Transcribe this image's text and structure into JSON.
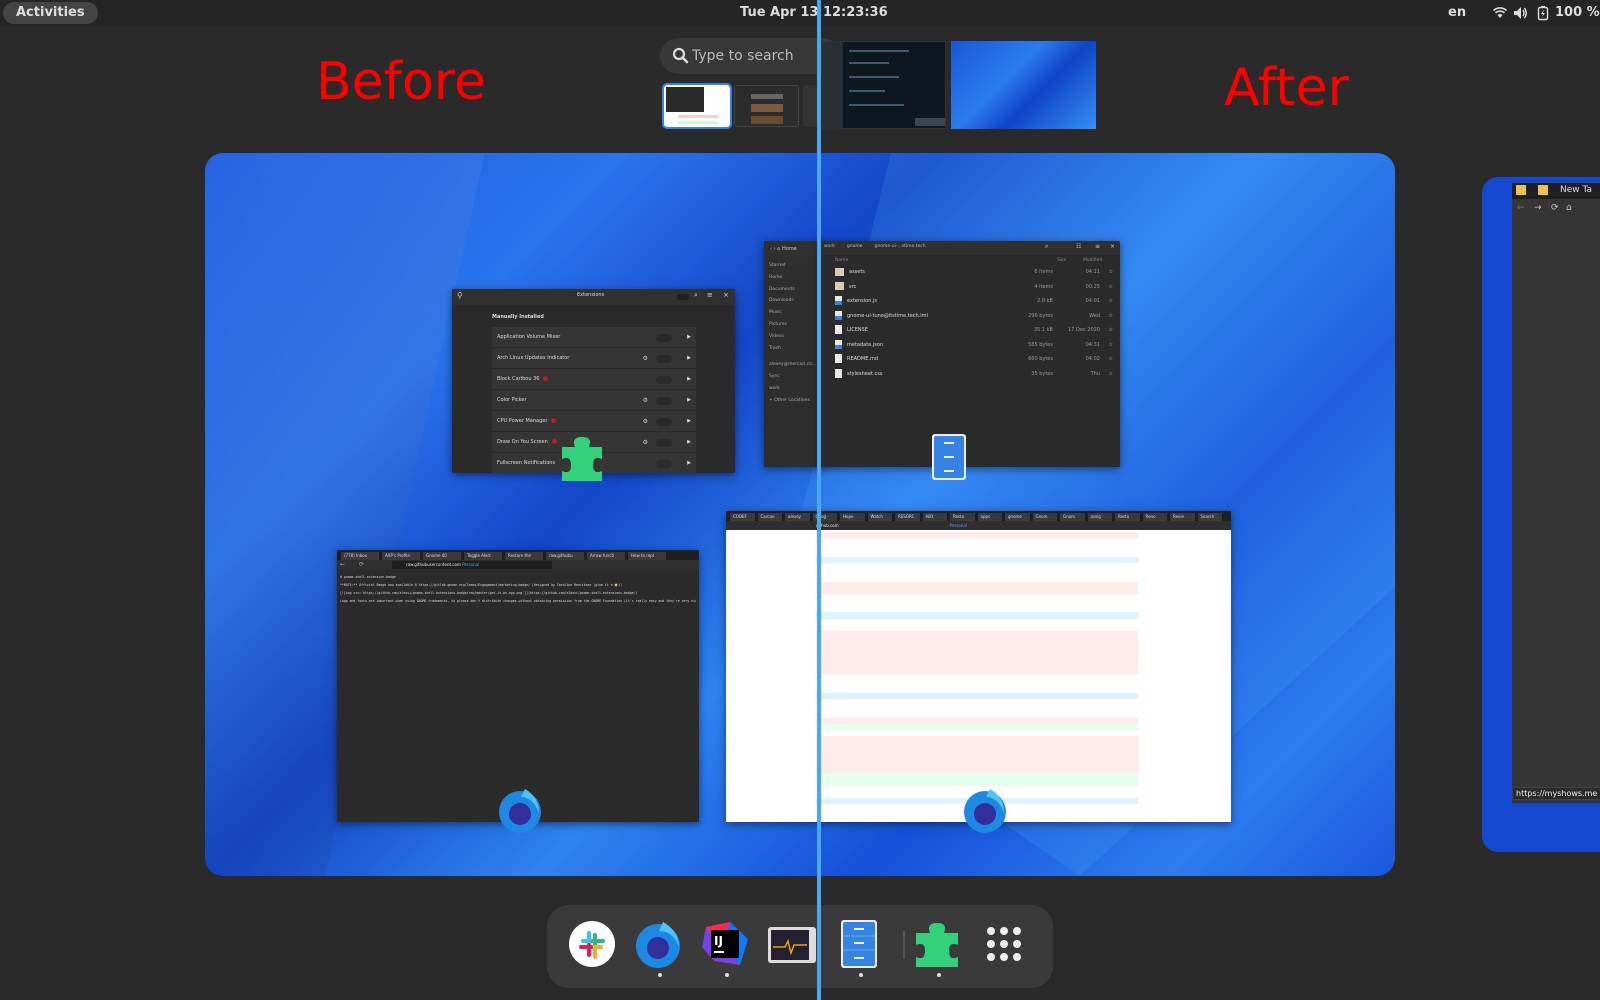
{
  "topbar": {
    "activities_label": "Activities",
    "clock": "Tue Apr 13  12:23:36",
    "keyboard_layout": "en",
    "battery_percent": "100 %",
    "tray_icons": [
      "wifi-icon",
      "volume-icon",
      "battery-charging-icon"
    ]
  },
  "search": {
    "placeholder": "Type to search",
    "icon": "search-icon"
  },
  "annotations": {
    "before_label": "Before",
    "after_label": "After",
    "label_color": "#ff0000",
    "divider_color": "#4aa8f0"
  },
  "workspace_thumbnails": [
    {
      "name": "workspace-1",
      "active": true
    },
    {
      "name": "workspace-2",
      "active": false
    },
    {
      "name": "workspace-3",
      "active": false
    },
    {
      "name": "workspace-4",
      "active": false
    },
    {
      "name": "workspace-5",
      "active": false
    }
  ],
  "extensions_window": {
    "title": "Extensions",
    "section_heading": "Manually Installed",
    "items": [
      {
        "label": "Application Volume Mixer",
        "has_settings": false,
        "has_error": false
      },
      {
        "label": "Arch Linux Updates Indicator",
        "has_settings": true,
        "has_error": false
      },
      {
        "label": "Block Caribou 36",
        "has_settings": false,
        "has_error": true
      },
      {
        "label": "Color Picker",
        "has_settings": true,
        "has_error": false
      },
      {
        "label": "CPU Power Manager",
        "has_settings": true,
        "has_error": true
      },
      {
        "label": "Draw On You Screen",
        "has_settings": true,
        "has_error": true
      },
      {
        "label": "Fullscreen Notifications",
        "has_settings": false,
        "has_error": false
      }
    ]
  },
  "files_window": {
    "back_sidebar_path": "Home",
    "path_segments": [
      "work",
      "gnome",
      "gnome-ui-...stime.tech"
    ],
    "columns": {
      "name": "Name",
      "size": "Size",
      "modified": "Modified"
    },
    "sidebar": [
      "Starred",
      "Home",
      "Documents",
      "Downloads",
      "Music",
      "Pictures",
      "Videos",
      "Trash",
      "alexey@mercari.co...",
      "Sync",
      "work",
      "+ Other Locations"
    ],
    "files": [
      {
        "name": "assets",
        "type": "folder",
        "size": "6 items",
        "modified": "04:11"
      },
      {
        "name": "src",
        "type": "folder",
        "size": "4 items",
        "modified": "00:25"
      },
      {
        "name": "extension.js",
        "type": "js",
        "size": "2.8 kB",
        "modified": "04:01"
      },
      {
        "name": "gnome-ui-tune@itstime.tech.iml",
        "type": "js",
        "size": "296 bytes",
        "modified": "Wed"
      },
      {
        "name": "LICENSE",
        "type": "text",
        "size": "35.1 kB",
        "modified": "17 Dec 2020"
      },
      {
        "name": "metadata.json",
        "type": "js",
        "size": "585 bytes",
        "modified": "04:31"
      },
      {
        "name": "README.md",
        "type": "text",
        "size": "660 bytes",
        "modified": "04:02"
      },
      {
        "name": "stylesheet.css",
        "type": "text",
        "size": "35 bytes",
        "modified": "Thu"
      }
    ]
  },
  "firefox_window_left": {
    "tabs": [
      "(778) Inbox",
      "AXP's Profile",
      "Gnome 40",
      "Toggle Alert",
      "Restore the",
      "raw.githubu",
      "Arrow functi",
      "How to repl"
    ],
    "url_host": "raw.githubusercontent.com",
    "container_label": "Personal",
    "content_lines": [
      "# gnome-shell-extension-badge",
      "**NOTE:** Official Badge now available @ https://gitlab.gnome.org/Teams/Engagement/marketing-badge/ (designed by Caroline Henriksen (give it a ⭐))",
      "[![img src='https://github.com/alexsi/gnome-shell-extensions-badge/raw/master/get-it-on-ego.png']](https://github.com/alexsi/gnome-shell-extensions-badge/)",
      "Logo and fonts are important when using GNOME trademarks, so please don't distribute changes without obtaining permission from the GNOME Foundation (it's really easy and they're very nice)."
    ]
  },
  "firefox_window_right": {
    "tabs": [
      "CODEF",
      "Carcan",
      "alexey",
      "Goog",
      "Hope",
      "Watch",
      "RESORC",
      "AB1",
      "Resto",
      "apps",
      "gnome",
      "Gnom",
      "Gnom",
      "assig",
      "Resto",
      "Reno",
      "Revie",
      "Search"
    ],
    "url_host": "github.com",
    "container_label": "Personal"
  },
  "partial_window": {
    "tab_label": "New Ta",
    "status_url": "https://myshows.me"
  },
  "dock": {
    "items": [
      {
        "name": "slack",
        "running": false
      },
      {
        "name": "firefox",
        "running": true
      },
      {
        "name": "intellij-idea",
        "running": true
      },
      {
        "name": "system-monitor",
        "running": false
      },
      {
        "name": "files",
        "running": true
      },
      {
        "name": "extensions",
        "running": true
      },
      {
        "name": "show-applications",
        "running": false
      }
    ]
  }
}
